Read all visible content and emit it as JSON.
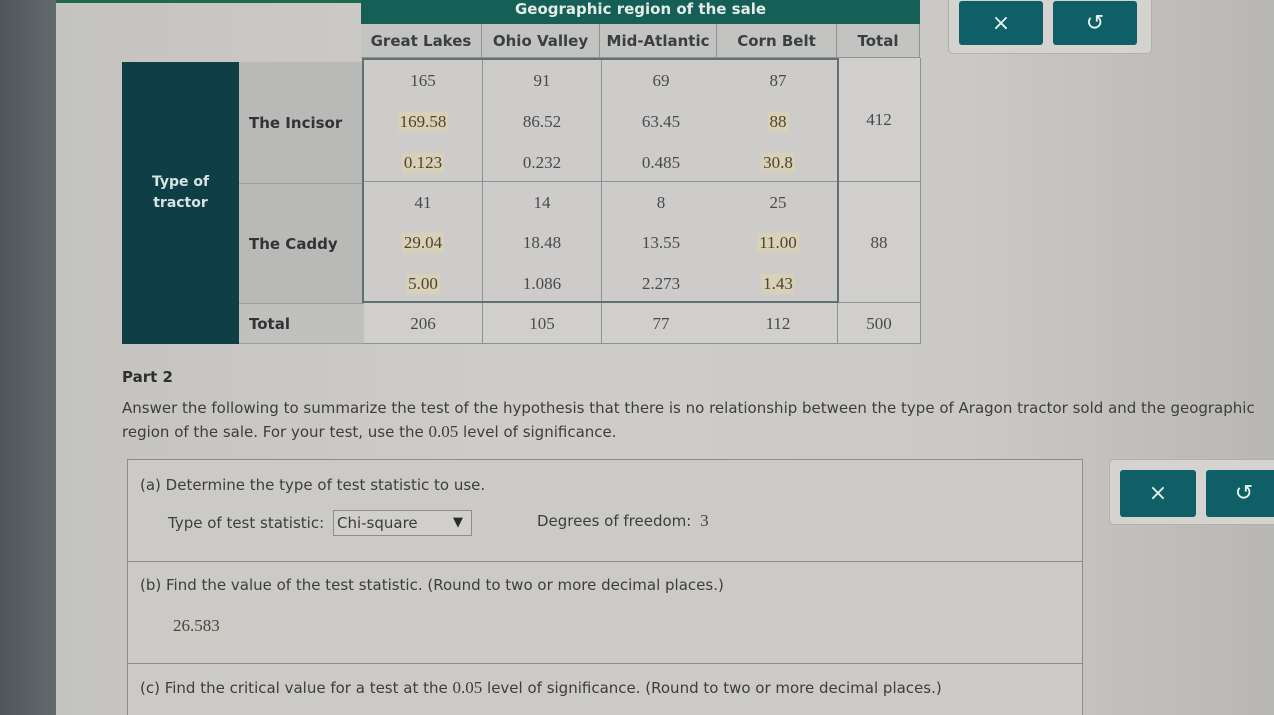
{
  "table": {
    "column_group_header": "Geographic region of the sale",
    "row_group_header": "Type of tractor",
    "columns": [
      "Great Lakes",
      "Ohio Valley",
      "Mid-Atlantic",
      "Corn Belt",
      "Total"
    ],
    "rows": [
      {
        "label": "The Incisor",
        "observed": [
          "165",
          "91",
          "69",
          "87"
        ],
        "expected": [
          "169.58",
          "86.52",
          "63.45",
          "88"
        ],
        "contribution": [
          "0.123",
          "0.232",
          "0.485",
          "30.8"
        ],
        "total": "412"
      },
      {
        "label": "The Caddy",
        "observed": [
          "41",
          "14",
          "8",
          "25"
        ],
        "expected": [
          "29.04",
          "18.48",
          "13.55",
          "11.00"
        ],
        "contribution": [
          "5.00",
          "1.086",
          "2.273",
          "1.43"
        ],
        "total": "88"
      }
    ],
    "total_row": {
      "label": "Total",
      "values": [
        "206",
        "105",
        "77",
        "112",
        "500"
      ]
    }
  },
  "tools_top": {
    "clear_icon": "×",
    "undo_icon": "↺"
  },
  "tools_mid": {
    "clear_icon": "×",
    "undo_icon": "↺"
  },
  "part2": {
    "title": "Part 2",
    "intro_line1": "Answer the following to summarize the test of the hypothesis that there is no relationship between the type of Aragon tractor sold and the geographic",
    "intro_line2_a": "region of the sale. For your test, use the ",
    "intro_line2_num": "0.05",
    "intro_line2_b": " level of significance."
  },
  "question_a": {
    "prompt": "(a) Determine the type of test statistic to use.",
    "type_label": "Type of test statistic:",
    "type_value": "Chi-square",
    "dof_label": "Degrees of freedom:",
    "dof_value": "3"
  },
  "question_b": {
    "prompt": "(b) Find the value of the test statistic. (Round to two or more decimal places.)",
    "answer": "26.583"
  },
  "question_c": {
    "prompt_a": "(c) Find the critical value for a test at the ",
    "prompt_num": "0.05",
    "prompt_b": " level of significance. (Round to two or more decimal places.)"
  }
}
